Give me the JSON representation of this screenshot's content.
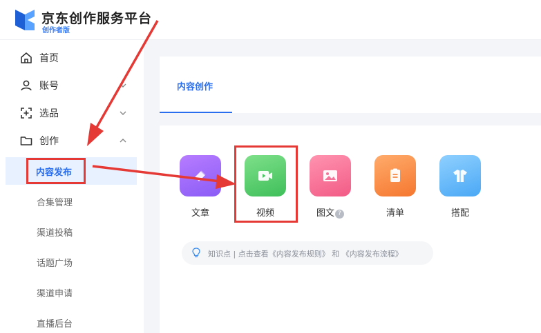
{
  "brand": {
    "title": "京东创作服务平台",
    "subtitle": "创作者版",
    "colors": {
      "blue": "#2a6ef0",
      "logo_dark": "#1f5fd6",
      "logo_light": "#5aa2ff"
    }
  },
  "sidebar": {
    "items": [
      {
        "label": "首页",
        "icon": "home-icon"
      },
      {
        "label": "账号",
        "icon": "user-icon",
        "chevron": "chevron-down-icon"
      },
      {
        "label": "选品",
        "icon": "scan-plus-icon",
        "chevron": "chevron-down-icon"
      },
      {
        "label": "创作",
        "icon": "folder-icon",
        "chevron": "chevron-up-icon"
      }
    ],
    "sub_items": [
      {
        "label": "内容发布",
        "active": true
      },
      {
        "label": "合集管理"
      },
      {
        "label": "渠道投稿"
      },
      {
        "label": "话题广场"
      },
      {
        "label": "渠道申请"
      },
      {
        "label": "直播后台"
      }
    ]
  },
  "main": {
    "tab_label": "内容创作",
    "tiles": [
      {
        "label": "文章",
        "icon": "article-icon",
        "color_top": "#b77cff",
        "color_bottom": "#8a5cf6"
      },
      {
        "label": "视频",
        "icon": "video-icon",
        "color_top": "#7ee08a",
        "color_bottom": "#3fbf5a"
      },
      {
        "label": "图文",
        "icon": "image-icon",
        "help": "?",
        "color_top": "#ff93b0",
        "color_bottom": "#f25b85"
      },
      {
        "label": "清单",
        "icon": "list-icon",
        "color_top": "#ffab6b",
        "color_bottom": "#f5772f"
      },
      {
        "label": "搭配",
        "icon": "shirt-icon",
        "color_top": "#8fd0ff",
        "color_bottom": "#4aa8f5"
      }
    ],
    "tip_text": "知识点 | 点击查看《内容发布规则》 和 《内容发布流程》"
  },
  "annotations": {
    "color": "#e53935"
  }
}
